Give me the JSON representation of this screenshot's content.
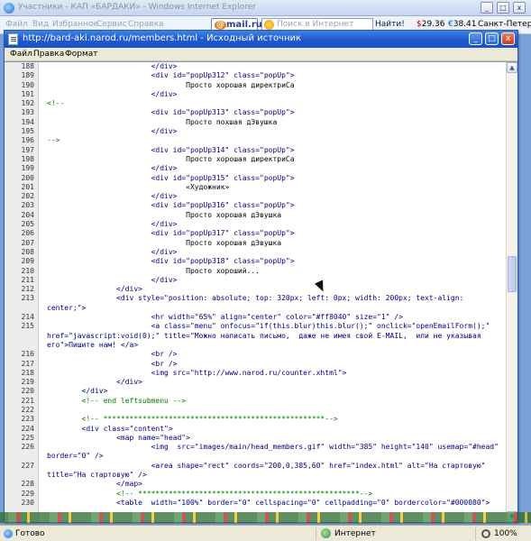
{
  "bg_window": {
    "title": "Участники - КАП «БАРДАКИ» - Windows Internet Explorer",
    "menu": [
      "Файл",
      "Вид",
      "Избранное",
      "Сервис",
      "Справка"
    ],
    "mail_logo": "mail.ru",
    "search_placeholder": "Поиск в Интернет",
    "find_label": "Найти!",
    "usd_rate": "29.36",
    "eur_rate": "38.41",
    "city": "Санкт-Петерб"
  },
  "source_window": {
    "title": "http://bard-aki.narod.ru/members.html - Исходный источник",
    "menu": [
      "Файл",
      "Правка",
      "Формат"
    ],
    "lines": [
      {
        "n": "188",
        "c": "                        </div>"
      },
      {
        "n": "189",
        "c": "                        <div id=\"popUp312\" class=\"popUp\">"
      },
      {
        "n": "190",
        "c": "                                Просто хорошая директриСа"
      },
      {
        "n": "191",
        "c": "                        </div>"
      },
      {
        "n": "192",
        "c": "<!--"
      },
      {
        "n": "193",
        "c": "                        <div id=\"popUp313\" class=\"popUp\">"
      },
      {
        "n": "194",
        "c": "                                Просто похшая дЭвушка"
      },
      {
        "n": "195",
        "c": "                        </div>"
      },
      {
        "n": "196",
        "c": "-->"
      },
      {
        "n": "197",
        "c": "                        <div id=\"popUp314\" class=\"popUp\">"
      },
      {
        "n": "198",
        "c": "                                Просто хорошая директриСа"
      },
      {
        "n": "199",
        "c": "                        </div>"
      },
      {
        "n": "200",
        "c": "                        <div id=\"popUp315\" class=\"popUp\">"
      },
      {
        "n": "201",
        "c": "                                «Художник»"
      },
      {
        "n": "202",
        "c": "                        </div>"
      },
      {
        "n": "203",
        "c": "                        <div id=\"popUp316\" class=\"popUp\">"
      },
      {
        "n": "204",
        "c": "                                Просто хорошая дЭвушка"
      },
      {
        "n": "205",
        "c": "                        </div>"
      },
      {
        "n": "206",
        "c": "                        <div id=\"popUp317\" class=\"popUp\">"
      },
      {
        "n": "207",
        "c": "                                Просто хорошая дЭвушка"
      },
      {
        "n": "208",
        "c": "                        </div>"
      },
      {
        "n": "209",
        "c": "                        <div id=\"popUp318\" class=\"popUp\">"
      },
      {
        "n": "210",
        "c": "                                Просто хороший..."
      },
      {
        "n": "211",
        "c": "                        </div>"
      },
      {
        "n": "212",
        "c": "                </div>"
      },
      {
        "n": "213",
        "c": "                <div style=\"position: absolute; top: 320px; left: 0px; width: 200px; text-align: center;\">"
      },
      {
        "n": "214",
        "c": "                        <hr width=\"65%\" align=\"center\" color=\"#ff8040\" size=\"1\" />"
      },
      {
        "n": "215",
        "c": "                        <a class=\"menu\" onfocus=\"if(this.blur)this.blur();\" onclick=\"openEmailForm();\" href=\"javascript:void(0);\" title=\"Можно написать письмо,  даже не имея свой E-MAIL,  или не указывая его\">Пишите нам! </a>"
      },
      {
        "n": "216",
        "c": "                        <br />"
      },
      {
        "n": "217",
        "c": "                        <br />"
      },
      {
        "n": "218",
        "c": "                        <img src=\"http://www.narod.ru/counter.xhtml\">"
      },
      {
        "n": "219",
        "c": "                </div>"
      },
      {
        "n": "220",
        "c": "        </div>"
      },
      {
        "n": "221",
        "c": "        <!-- end leftsubmenu -->"
      },
      {
        "n": "222",
        "c": ""
      },
      {
        "n": "223",
        "c": "        <!-- ***************************************************-->"
      },
      {
        "n": "224",
        "c": "        <div class=\"content\">"
      },
      {
        "n": "225",
        "c": "                <map name=\"head\">"
      },
      {
        "n": "226",
        "c": "                        <img  src=\"images/main/head_members.gif\" width=\"385\" height=\"140\" usemap=\"#head\" border=\"0\" />"
      },
      {
        "n": "227",
        "c": "                        <area shape=\"rect\" coords=\"200,0,385,60\" href=\"index.html\" alt=\"На стартовую\" title=\"На стартовую\" />"
      },
      {
        "n": "228",
        "c": "                </map>"
      },
      {
        "n": "229",
        "c": "                <!-- ***************************************************-->"
      },
      {
        "n": "230",
        "c": "                <table  width=\"100%\" border=\"0\" cellspacing=\"0\" cellpadding=\"0\" bordercolor=\"#000080\">"
      }
    ]
  },
  "statusbar": {
    "status": "Готово",
    "zone": "Интернет",
    "zoom": "100%"
  }
}
